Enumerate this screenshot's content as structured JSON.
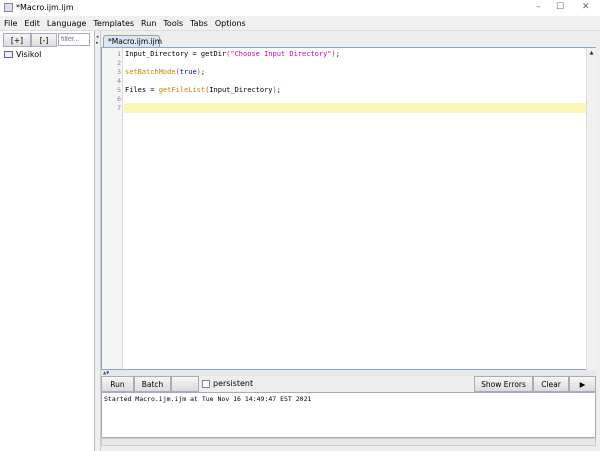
{
  "window": {
    "title": "*Macro.ijm.ijm",
    "minimize": "–",
    "maximize": "☐",
    "close": "✕"
  },
  "menu": [
    "File",
    "Edit",
    "Language",
    "Templates",
    "Run",
    "Tools",
    "Tabs",
    "Options"
  ],
  "left": {
    "expand_label": "[+]",
    "collapse_label": "[-]",
    "filter_placeholder": "filter...",
    "tree": [
      {
        "label": "Visikol"
      }
    ]
  },
  "editor": {
    "tab": "*Macro.ijm.ijm",
    "lines": [
      {
        "n": "1",
        "parts": [
          [
            "Input_Directory = ",
            ""
          ],
          [
            "getDir",
            ""
          ],
          [
            "(",
            "par"
          ],
          [
            "\"Choose Input Directory\"",
            "str"
          ],
          [
            ")",
            "par"
          ],
          [
            ";",
            ""
          ]
        ]
      },
      {
        "n": "2",
        "parts": []
      },
      {
        "n": "3",
        "parts": [
          [
            "setBatchMode",
            "kw"
          ],
          [
            "(",
            "par"
          ],
          [
            "true",
            "bool"
          ],
          [
            ")",
            "par"
          ],
          [
            ";",
            ""
          ]
        ]
      },
      {
        "n": "4",
        "parts": []
      },
      {
        "n": "5",
        "parts": [
          [
            "Files = ",
            ""
          ],
          [
            "getFileList",
            "kw"
          ],
          [
            "(",
            "par"
          ],
          [
            "Input_Directory",
            ""
          ],
          [
            ")",
            "par"
          ],
          [
            ";",
            ""
          ]
        ]
      },
      {
        "n": "6",
        "parts": []
      },
      {
        "n": "7",
        "parts": []
      }
    ]
  },
  "console": {
    "run": "Run",
    "batch": "Batch",
    "persistent": "persistent",
    "show_errors": "Show Errors",
    "clear": "Clear",
    "play": "▶",
    "output": "Started Macro.ijm.ijm at Tue Nov 16 14:49:47 EST 2021"
  }
}
